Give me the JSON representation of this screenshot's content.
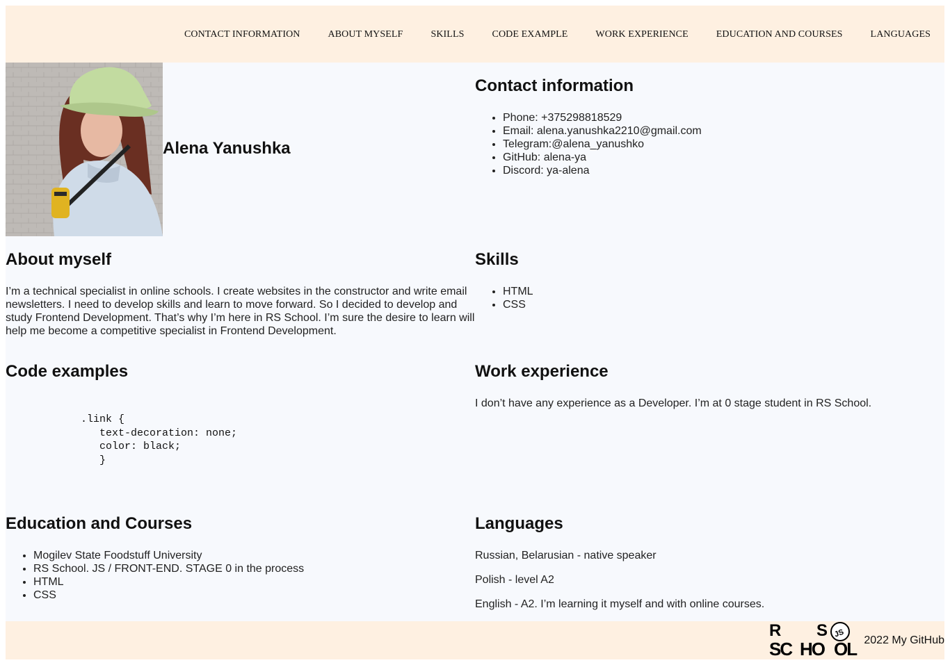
{
  "nav": {
    "items": [
      {
        "label": "CONTACT INFORMATION"
      },
      {
        "label": "ABOUT MYSELF"
      },
      {
        "label": "SKILLS"
      },
      {
        "label": "CODE EXAMPLE"
      },
      {
        "label": "WORK EXPERIENCE"
      },
      {
        "label": "EDUCATION AND COURSES"
      },
      {
        "label": "LANGUAGES"
      }
    ]
  },
  "profile": {
    "name": "Alena Yanushka"
  },
  "contacts": {
    "title": "Contact information",
    "items": [
      "Phone: +375298818529",
      "Email: alena.yanushka2210@gmail.com",
      "Telegram:@alena_yanushko",
      "GitHub: alena-ya",
      "Discord: ya-alena"
    ]
  },
  "about": {
    "title": "About myself",
    "text": "I’m a technical specialist in online schools. I create websites in the constructor and write email newsletters. I need to develop skills and learn to move forward. So I decided to develop and study Frontend Development. That’s why I’m here in RS School. I’m sure the desire to learn will help me become a competitive specialist in Frontend Development."
  },
  "skills": {
    "title": "Skills",
    "items": [
      "HTML",
      "CSS"
    ]
  },
  "code": {
    "title": "Code examples",
    "lines": [
      "            .link {",
      "               text-decoration: none;",
      "               color: black;",
      "               }"
    ]
  },
  "work": {
    "title": "Work experience",
    "text": "I don’t have any experience as a Developer. I’m at 0 stage student in RS School."
  },
  "education": {
    "title": "Education and Courses",
    "items": [
      "Mogilev State Foodstuff University",
      "RS School. JS / FRONT-END. STAGE 0 in the process",
      "HTML",
      "CSS"
    ]
  },
  "languages": {
    "title": "Languages",
    "items": [
      "Russian, Belarusian - native speaker",
      "Polish - level A2",
      "English - A2. I’m learning it myself and with online courses."
    ]
  },
  "footer": {
    "logo": {
      "r": "R",
      "s": "S",
      "sc": "SC",
      "ho": "HO",
      "ol": "OL",
      "js": "JS"
    },
    "year": "2022",
    "github_link": "My GitHub"
  },
  "colors": {
    "band": "#fef0e1",
    "page_bg": "#f7f9fd"
  },
  "icons": {
    "school_logo": "rs-school-logo",
    "photo": "profile-photo"
  }
}
